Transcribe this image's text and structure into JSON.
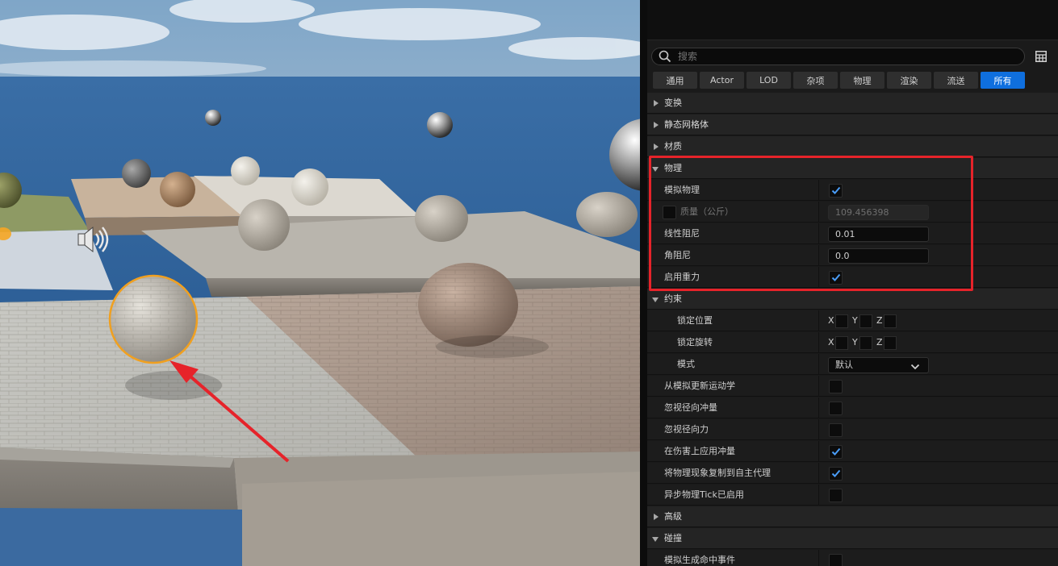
{
  "viewport": {
    "description_icons": [
      "speaker-icon"
    ],
    "highlight_color": "#e6232a",
    "selection_color": "#f0a020"
  },
  "details": {
    "search": {
      "placeholder": "搜索",
      "value": ""
    },
    "filters": [
      {
        "label": "通用",
        "active": false
      },
      {
        "label": "Actor",
        "active": false
      },
      {
        "label": "LOD",
        "active": false
      },
      {
        "label": "杂项",
        "active": false
      },
      {
        "label": "物理",
        "active": false
      },
      {
        "label": "渲染",
        "active": false
      },
      {
        "label": "流送",
        "active": false
      },
      {
        "label": "所有",
        "active": true
      }
    ],
    "rows": [
      {
        "kind": "cat",
        "label": "变换",
        "expanded": false
      },
      {
        "kind": "cat",
        "label": "静态网格体",
        "expanded": false
      },
      {
        "kind": "cat",
        "label": "材质",
        "expanded": false
      },
      {
        "kind": "cat",
        "label": "物理",
        "expanded": true
      },
      {
        "kind": "prop",
        "label": "模拟物理",
        "control": "check",
        "checked": true
      },
      {
        "kind": "prop",
        "label": "质量（公斤）",
        "control": "field",
        "value": "109.456398",
        "disabled": true,
        "leading_check": true
      },
      {
        "kind": "prop",
        "label": "线性阻尼",
        "control": "field",
        "value": "0.01"
      },
      {
        "kind": "prop",
        "label": "角阻尼",
        "control": "field",
        "value": "0.0"
      },
      {
        "kind": "prop",
        "label": "启用重力",
        "control": "check",
        "checked": true
      },
      {
        "kind": "cat",
        "label": "约束",
        "expanded": true
      },
      {
        "kind": "prop",
        "label": "锁定位置",
        "control": "xyz",
        "indent": true,
        "axes": [
          "X",
          "Y",
          "Z"
        ]
      },
      {
        "kind": "prop",
        "label": "锁定旋转",
        "control": "xyz",
        "indent": true,
        "axes": [
          "X",
          "Y",
          "Z"
        ]
      },
      {
        "kind": "prop",
        "label": "模式",
        "control": "dropdown",
        "indent": true,
        "value": "默认"
      },
      {
        "kind": "prop",
        "label": "从模拟更新运动学",
        "control": "check",
        "checked": false
      },
      {
        "kind": "prop",
        "label": "忽视径向冲量",
        "control": "check",
        "checked": false
      },
      {
        "kind": "prop",
        "label": "忽视径向力",
        "control": "check",
        "checked": false
      },
      {
        "kind": "prop",
        "label": "在伤害上应用冲量",
        "control": "check",
        "checked": true
      },
      {
        "kind": "prop",
        "label": "将物理现象复制到自主代理",
        "control": "check",
        "checked": true
      },
      {
        "kind": "prop",
        "label": "异步物理Tick已启用",
        "control": "check",
        "checked": false
      },
      {
        "kind": "cat",
        "label": "高级",
        "expanded": false
      },
      {
        "kind": "cat",
        "label": "碰撞",
        "expanded": true
      },
      {
        "kind": "prop",
        "label": "模拟生成命中事件",
        "control": "check",
        "checked": false
      }
    ]
  }
}
